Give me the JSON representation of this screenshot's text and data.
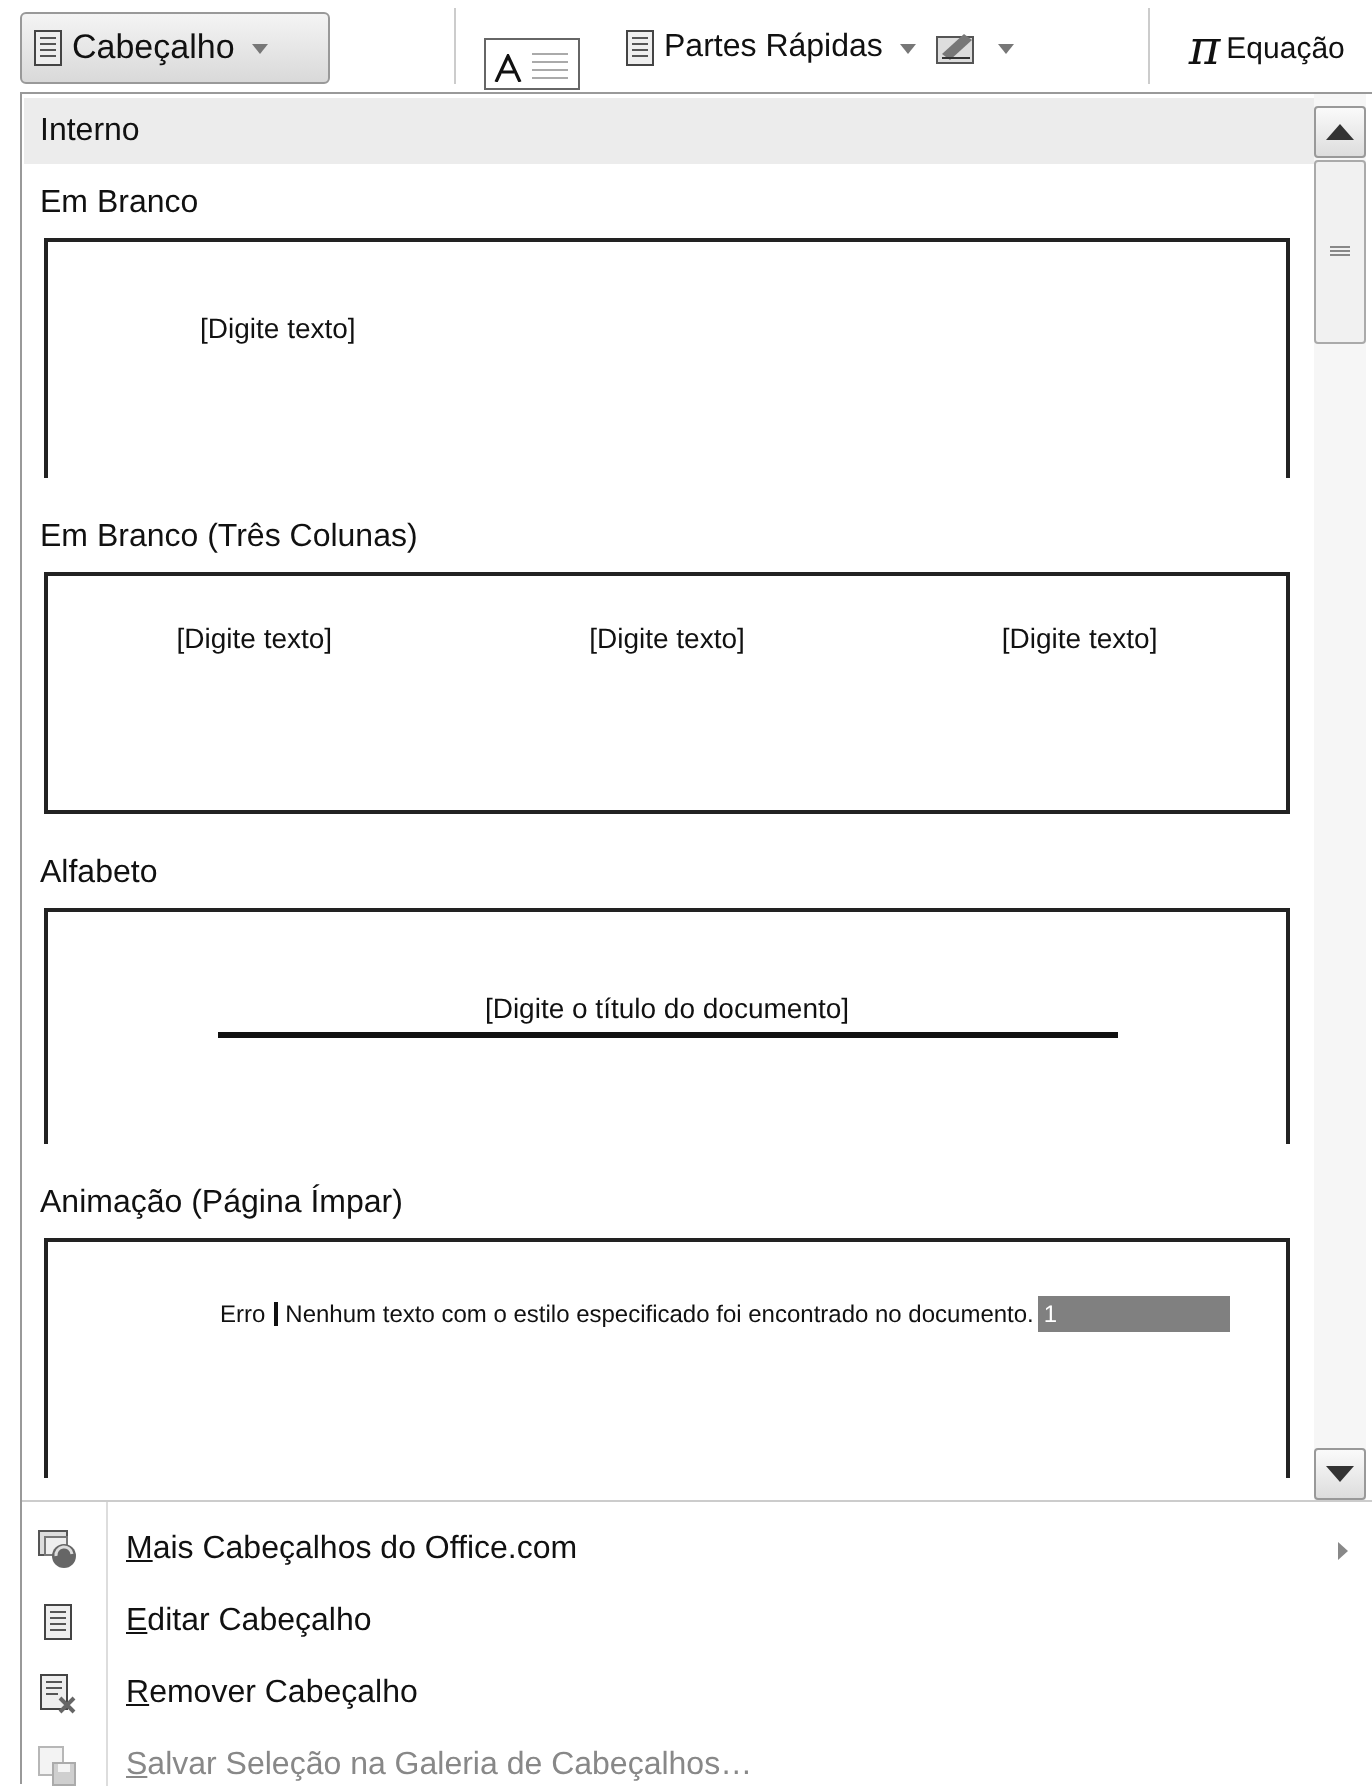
{
  "toolbar": [
    {
      "kind": "header",
      "label": "Cabeçalho",
      "pressed": true
    },
    {
      "kind": "textbox"
    },
    {
      "kind": "quickparts",
      "label": "Partes Rápidas"
    },
    {
      "kind": "signature"
    },
    {
      "kind": "equation",
      "symbol": "π",
      "label": "Equação"
    }
  ],
  "gallery": {
    "category": "Interno",
    "items": [
      {
        "kind": "blank",
        "title": "Em Branco",
        "texts": [
          "[Digite texto]"
        ]
      },
      {
        "kind": "columns",
        "title": "Em Branco (Três Colunas)",
        "texts": [
          "[Digite texto]",
          "[Digite texto]",
          "[Digite texto]"
        ]
      },
      {
        "kind": "alphabet",
        "title": "Alfabeto",
        "texts": [
          "[Digite o título do documento]"
        ]
      },
      {
        "kind": "animation",
        "title": "Animação (Página Ímpar)",
        "texts": [
          "Erro",
          "Nenhum texto com o estilo especificado foi encontrado no documento.",
          "1"
        ]
      }
    ]
  },
  "menu": [
    {
      "access_key": "M",
      "rest": "ais Cabeçalhos do Office.com",
      "disabled": false,
      "submenu": true
    },
    {
      "access_key": "E",
      "rest": "ditar Cabeçalho",
      "disabled": false,
      "submenu": false
    },
    {
      "access_key": "R",
      "rest": "emover Cabeçalho",
      "disabled": false,
      "submenu": false
    },
    {
      "access_key": "S",
      "rest": "alvar Seleção na Galeria de Cabeçalhos…",
      "disabled": true,
      "submenu": false
    }
  ]
}
